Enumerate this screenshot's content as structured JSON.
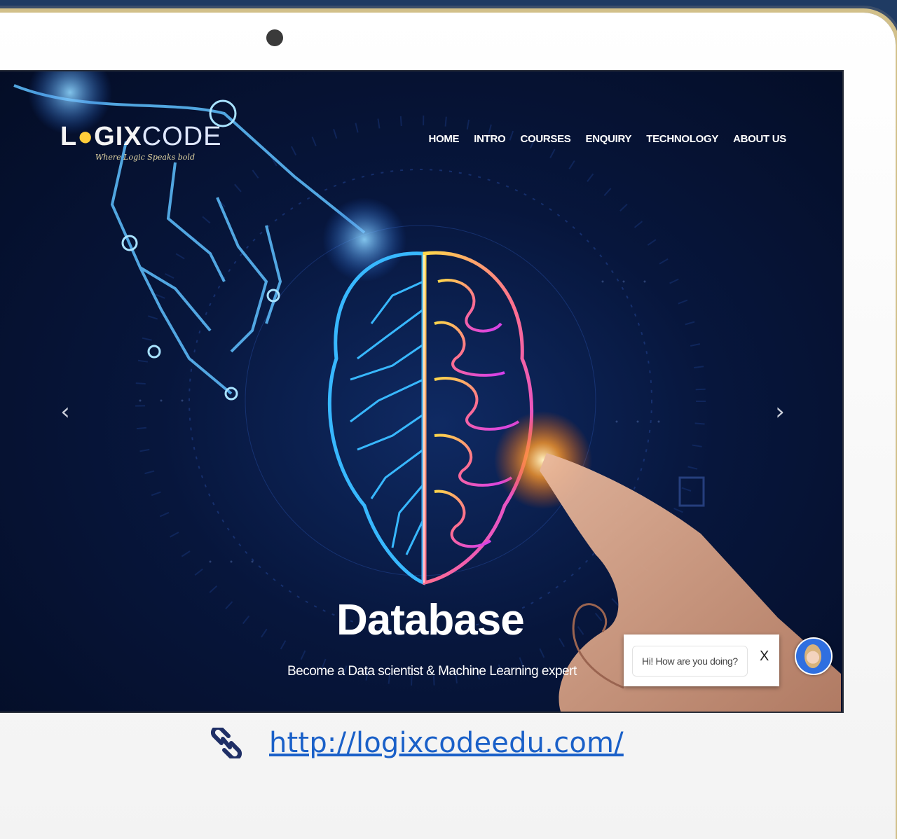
{
  "site": {
    "logo_bold": "GIX",
    "logo_light": "CODE",
    "logo_prefix": "L",
    "tagline": "Where Logic Speaks bold"
  },
  "nav": {
    "items": [
      "HOME",
      "INTRO",
      "COURSES",
      "ENQUIRY",
      "TECHNOLOGY",
      "ABOUT US"
    ]
  },
  "hero": {
    "title": "Database",
    "subtitle": "Become a Data scientist & Machine Learning expert"
  },
  "carousel": {
    "prev_icon": "chevron-left-icon",
    "next_icon": "chevron-right-icon"
  },
  "chat": {
    "message": "Hi! How are you doing?",
    "close_label": "X"
  },
  "footer": {
    "url": "http://logixcodeedu.com/",
    "link_icon": "link-icon"
  },
  "colors": {
    "background": "#1f3b63",
    "hero_dark": "#07163c",
    "brain_left": "#38b8ff",
    "brain_right": "#e24bd6",
    "glow": "#ff9a2a",
    "link": "#1a60c8"
  }
}
